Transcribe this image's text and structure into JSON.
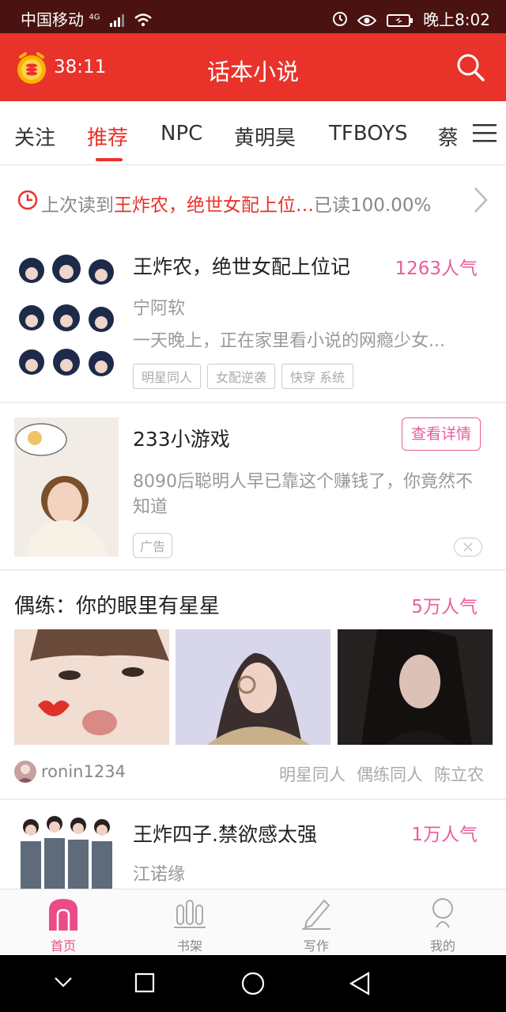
{
  "status_bar": {
    "carrier": "中国移动",
    "network": "4G",
    "time": "晚上8:02"
  },
  "app_bar": {
    "timer": "38:11",
    "title": "话本小说"
  },
  "tabs": [
    "关注",
    "推荐",
    "NPC",
    "黄明昊",
    "TFBOYS",
    "蔡徐"
  ],
  "active_tab": "推荐",
  "last_read": {
    "prefix": "上次读到",
    "book": "王炸农，绝世女配上位…",
    "progress": "已读100.00%"
  },
  "book1": {
    "title": "王炸农，绝世女配上位记",
    "popularity": "1263人气",
    "author": "宁阿软",
    "description": "一天晚上，正在家里看小说的网瘾少女...",
    "tags": [
      "明星同人",
      "女配逆袭",
      "快穿 系统"
    ]
  },
  "ad": {
    "title": "233小游戏",
    "cta": "查看详情",
    "description": "8090后聪明人早已靠这个赚钱了，你竟然不知道",
    "label": "广告"
  },
  "story": {
    "title": "偶练：你的眼里有星星",
    "popularity": "5万人气",
    "user": "ronin1234",
    "tags": [
      "明星同人",
      "偶练同人",
      "陈立农"
    ]
  },
  "book2": {
    "title": "王炸四子.禁欲感太强",
    "popularity": "1万人气",
    "author": "江诺缘"
  },
  "bottom_nav": [
    "首页",
    "书架",
    "写作",
    "我的"
  ],
  "colors": {
    "brand_red": "#e8322a",
    "accent_pink": "#e85d9d",
    "status_bar": "#4a1210"
  }
}
